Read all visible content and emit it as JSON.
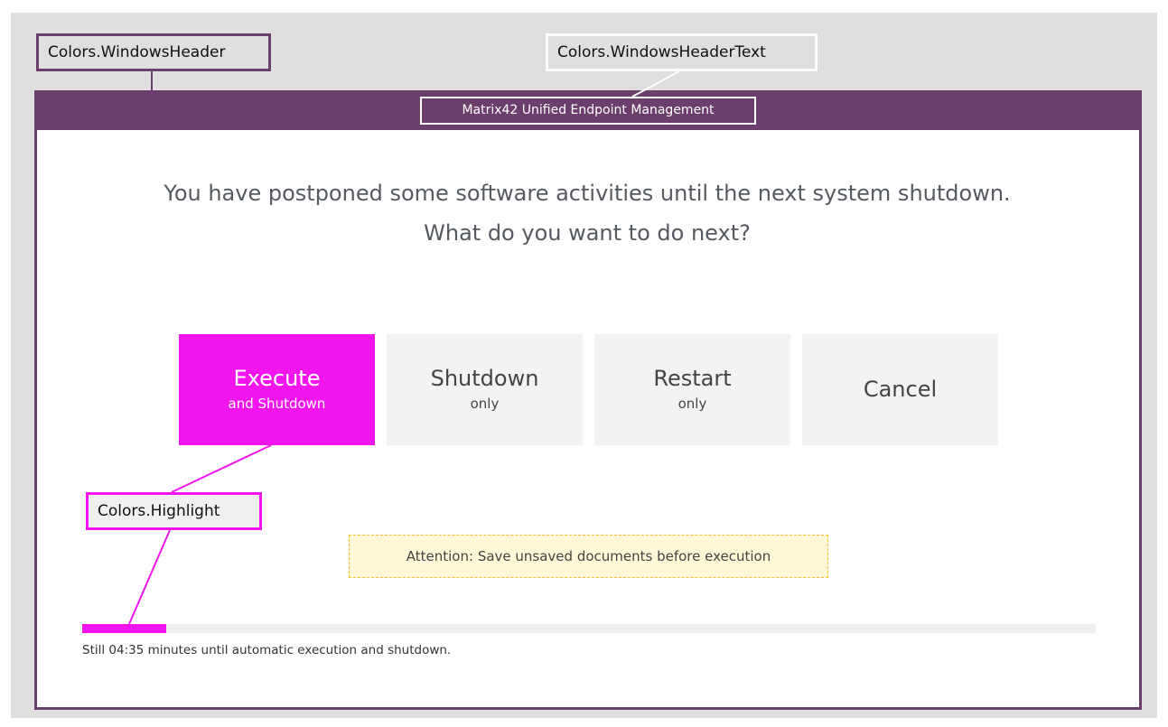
{
  "annotations": {
    "windows_header": "Colors.WindowsHeader",
    "windows_header_text": "Colors.WindowsHeaderText",
    "highlight": "Colors.Highlight"
  },
  "window": {
    "title": "Matrix42 Unified Endpoint Management"
  },
  "dialog": {
    "question_line1": "You have postponed some software activities until the next system shutdown.",
    "question_line2": "What do you want to do next?",
    "buttons": [
      {
        "main": "Execute",
        "sub": "and Shutdown"
      },
      {
        "main": "Shutdown",
        "sub": "only"
      },
      {
        "main": "Restart",
        "sub": "only"
      },
      {
        "main": "Cancel",
        "sub": ""
      }
    ],
    "attention": "Attention: Save unsaved documents before execution",
    "progress_fraction": 0.083,
    "countdown": "Still 04:35 minutes until automatic execution and shutdown."
  },
  "colors": {
    "windows_header": "#6b3f6b",
    "windows_header_text": "#ffffff",
    "highlight": "#f215ee"
  }
}
